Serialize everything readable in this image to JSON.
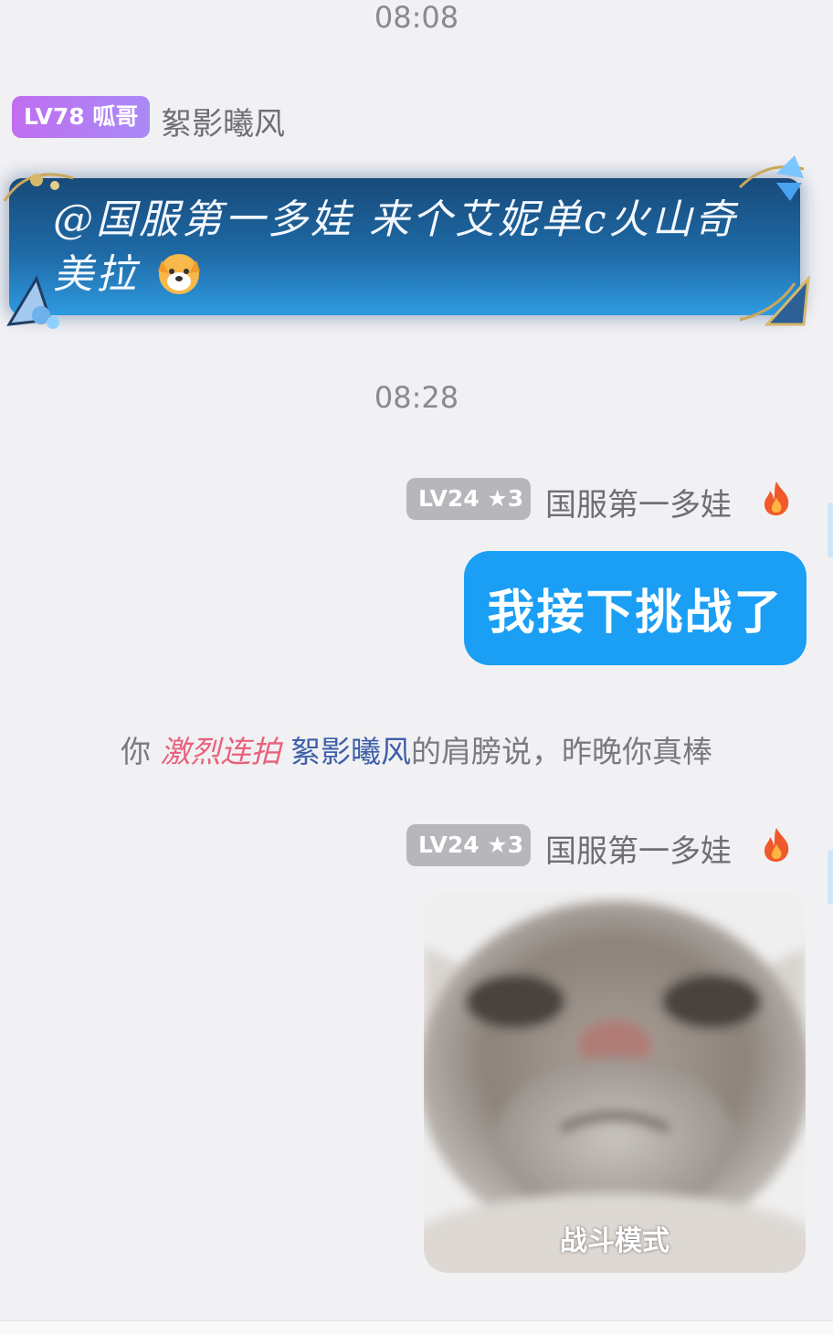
{
  "timestamps": [
    "08:08",
    "08:28"
  ],
  "messages": [
    {
      "badge": "LV78 呱哥",
      "sender": "絮影曦风",
      "text": "@国服第一多娃 来个艾妮单c火山奇美拉"
    },
    {
      "badge": "LV24 ★3",
      "sender": "国服第一多娃",
      "text": "我接下挑战了"
    },
    {
      "badge": "LV24 ★3",
      "sender": "国服第一多娃",
      "image_caption": "战斗模式"
    }
  ],
  "system": {
    "prefix": "你",
    "action": "激烈连拍",
    "target": "絮影曦风",
    "suffix": "的肩膀说，昨晚你真棒"
  },
  "icons": {
    "emoji": "dog-face-emoji",
    "flame": "flame-icon"
  },
  "colors": {
    "bubble_blue": "#1a9ff5",
    "badge_purple": "#b47cf3",
    "badge_gray": "#b6b6bb",
    "fancy_bubble": "#1e6aa6"
  }
}
